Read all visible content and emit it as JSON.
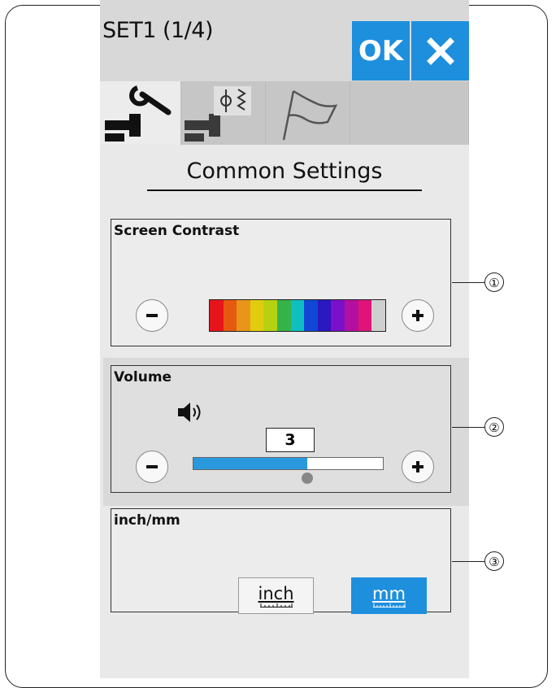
{
  "header": {
    "title": "SET1 (1/4)",
    "ok_label": "OK"
  },
  "tabs": [
    {
      "icon": "wrench-machine-icon"
    },
    {
      "icon": "stitch-machine-icon"
    },
    {
      "icon": "flag-icon"
    },
    {
      "icon": "empty"
    }
  ],
  "page_title": "Common Settings",
  "screen_contrast": {
    "label": "Screen Contrast",
    "colors": [
      "#e8141c",
      "#e65a10",
      "#e8951a",
      "#e2cc10",
      "#b4d212",
      "#35b34a",
      "#0fbfbf",
      "#1246d4",
      "#2a18c0",
      "#7a10c8",
      "#b410a0",
      "#e01478",
      "#cfcfcf"
    ]
  },
  "volume": {
    "label": "Volume",
    "value": "3",
    "level_fraction": 0.6
  },
  "units": {
    "label": "inch/mm",
    "inch_label": "inch",
    "mm_label": "mm",
    "selected": "mm"
  },
  "callouts": [
    "①",
    "②",
    "③"
  ],
  "colors": {
    "accent": "#1e8fdd",
    "panel_bg": "#ececec",
    "header_bg": "#d8d8d8"
  }
}
